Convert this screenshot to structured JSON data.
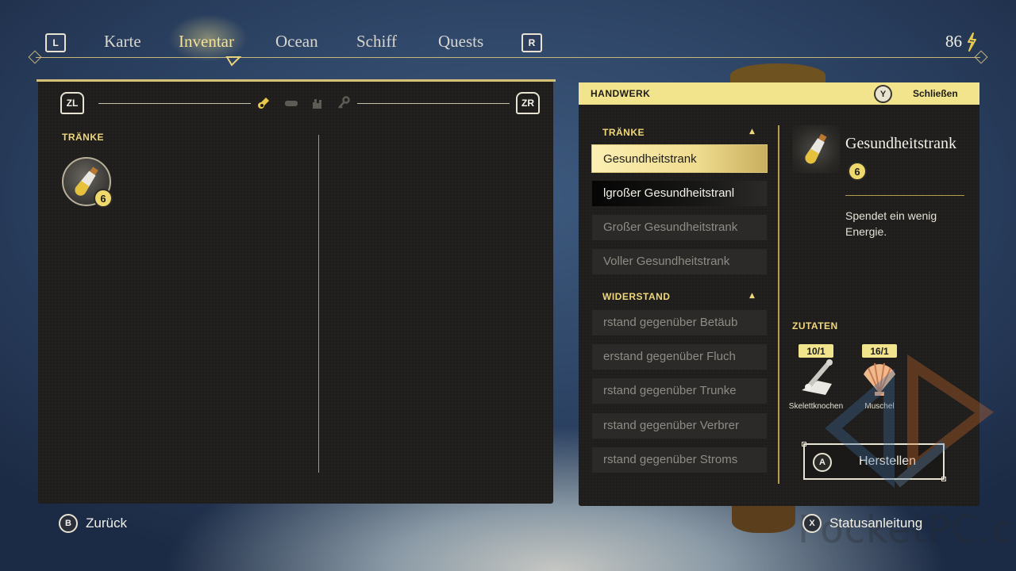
{
  "nav": {
    "left_shoulder": "L",
    "right_shoulder": "R",
    "tabs": [
      "Karte",
      "Inventar",
      "Ocean",
      "Schiff",
      "Quests"
    ],
    "active_tab": "Inventar",
    "currency_amount": "86"
  },
  "inventory": {
    "left_trigger": "ZL",
    "right_trigger": "ZR",
    "filter_icons": [
      "potion-icon",
      "log-icon",
      "glove-icon",
      "key-icon"
    ],
    "active_filter": "potion-icon",
    "section_title": "TRÄNKE",
    "items": [
      {
        "icon": "potion-icon",
        "count": "6"
      }
    ]
  },
  "crafting": {
    "header_title": "HANDWERK",
    "close_button_key": "Y",
    "close_label": "Schließen",
    "categories": [
      {
        "title": "TRÄNKE",
        "recipes": [
          "Gesundheitstrank",
          "lgroßer Gesundheitstranl",
          "Großer Gesundheitstrank",
          "Voller Gesundheitstrank"
        ]
      },
      {
        "title": "WIDERSTAND",
        "recipes": [
          "rstand gegenüber Betäub",
          "erstand gegenüber Fluch",
          "rstand gegenüber Trunke",
          "rstand gegenüber Verbrer",
          "rstand gegenüber Stroms"
        ]
      }
    ],
    "selected_recipe": "Gesundheitstrank",
    "detail": {
      "name": "Gesundheitstrank",
      "owned_count": "6",
      "description": "Spendet ein wenig Energie."
    },
    "ingredients_title": "ZUTATEN",
    "ingredients": [
      {
        "name": "Skelettknochen",
        "count": "10/1",
        "icon": "bone-icon"
      },
      {
        "name": "Muschel",
        "count": "16/1",
        "icon": "shell-icon"
      }
    ],
    "craft_button_key": "A",
    "craft_button_label": "Herstellen"
  },
  "footer": {
    "back_key": "B",
    "back_label": "Zurück",
    "status_key": "X",
    "status_label": "Statusanleitung"
  },
  "watermark": "PocketPC.ch",
  "colors": {
    "accent_gold": "#f0d77a",
    "header_yellow": "#f2e48c",
    "panel_bg": "#1f1e1d",
    "background_blue": "#2c4263"
  }
}
